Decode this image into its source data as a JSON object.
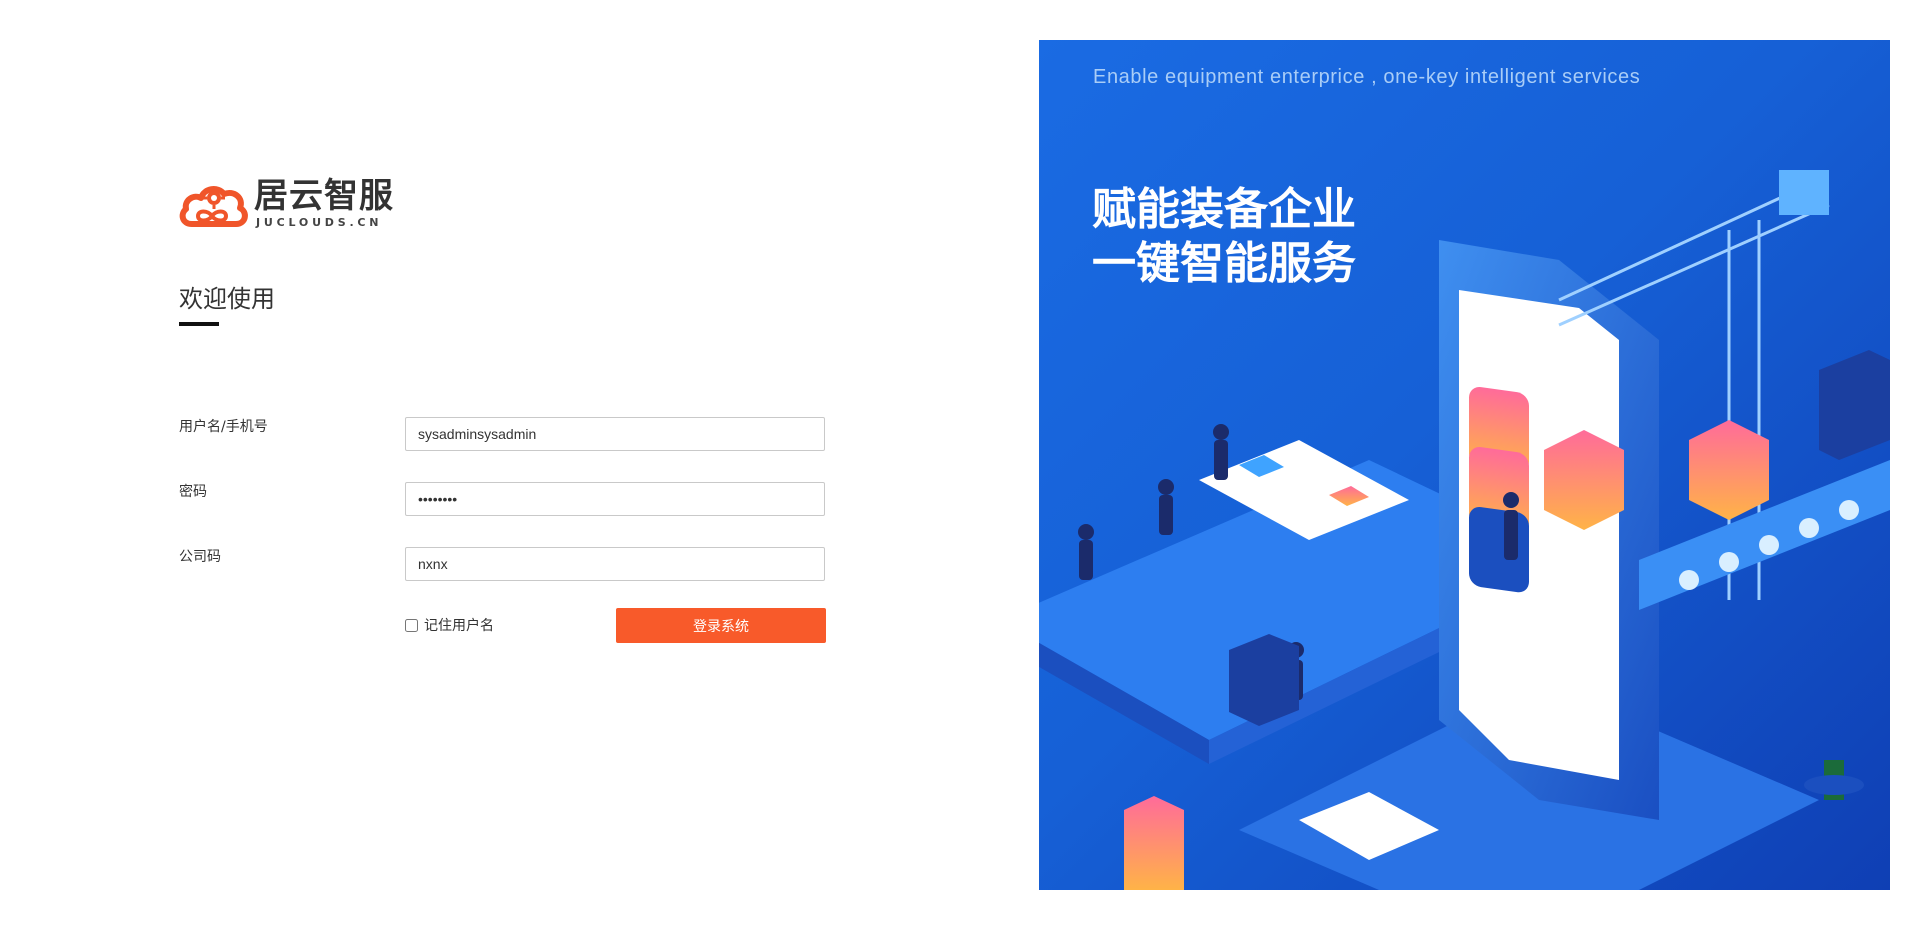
{
  "brand": {
    "name_cn": "居云智服",
    "name_en": "JUCLOUDS.CN",
    "colors": {
      "accent": "#f85a2a",
      "banner": "#1660d6"
    }
  },
  "welcome": {
    "title": "欢迎使用"
  },
  "form": {
    "username": {
      "label": "用户名/手机号",
      "value": "sysadminsysadmin"
    },
    "password": {
      "label": "密码",
      "value": "sysadmin"
    },
    "company": {
      "label": "公司码",
      "value": "nxnx"
    },
    "remember": {
      "label": "记住用户名",
      "checked": false
    },
    "submit_label": "登录系统"
  },
  "banner": {
    "tagline_en": "Enable equipment enterprice , one-key intelligent  services",
    "headline_line1": "赋能装备企业",
    "headline_line2": "一键智能服务"
  }
}
